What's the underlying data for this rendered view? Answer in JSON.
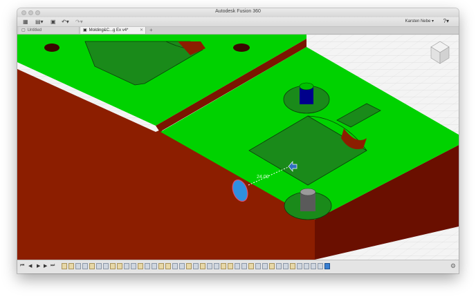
{
  "app": {
    "title": "Autodesk Fusion 360"
  },
  "toolbar": {
    "user": "Karsten Nebe ▾",
    "help_icon": "?"
  },
  "tabs": [
    {
      "label": "Untitled",
      "active": false
    },
    {
      "label": "Molding&C...g Ex v4*",
      "active": true
    }
  ],
  "viewport": {
    "measure_label": "24.00",
    "colors": {
      "top_face": "#00d200",
      "side_face": "#8c1e00",
      "dark_side": "#6a0f00",
      "grid_bg": "#f4f4f4",
      "grid_line": "#d3d3d3",
      "selection": "#2f8fe0"
    }
  },
  "timeline": {
    "features": [
      "sketch",
      "sketch",
      "extrude",
      "extrude",
      "sketch",
      "extrude",
      "extrude",
      "sketch",
      "sketch",
      "extrude",
      "extrude",
      "sketch",
      "extrude",
      "extrude",
      "sketch",
      "sketch",
      "extrude",
      "extrude",
      "sketch",
      "extrude",
      "sketch",
      "extrude",
      "extrude",
      "sketch",
      "sketch",
      "extrude",
      "extrude",
      "sketch",
      "extrude",
      "extrude",
      "sketch",
      "extrude",
      "extrude",
      "sketch",
      "extrude",
      "extrude",
      "extrude",
      "extrude",
      "active"
    ]
  }
}
